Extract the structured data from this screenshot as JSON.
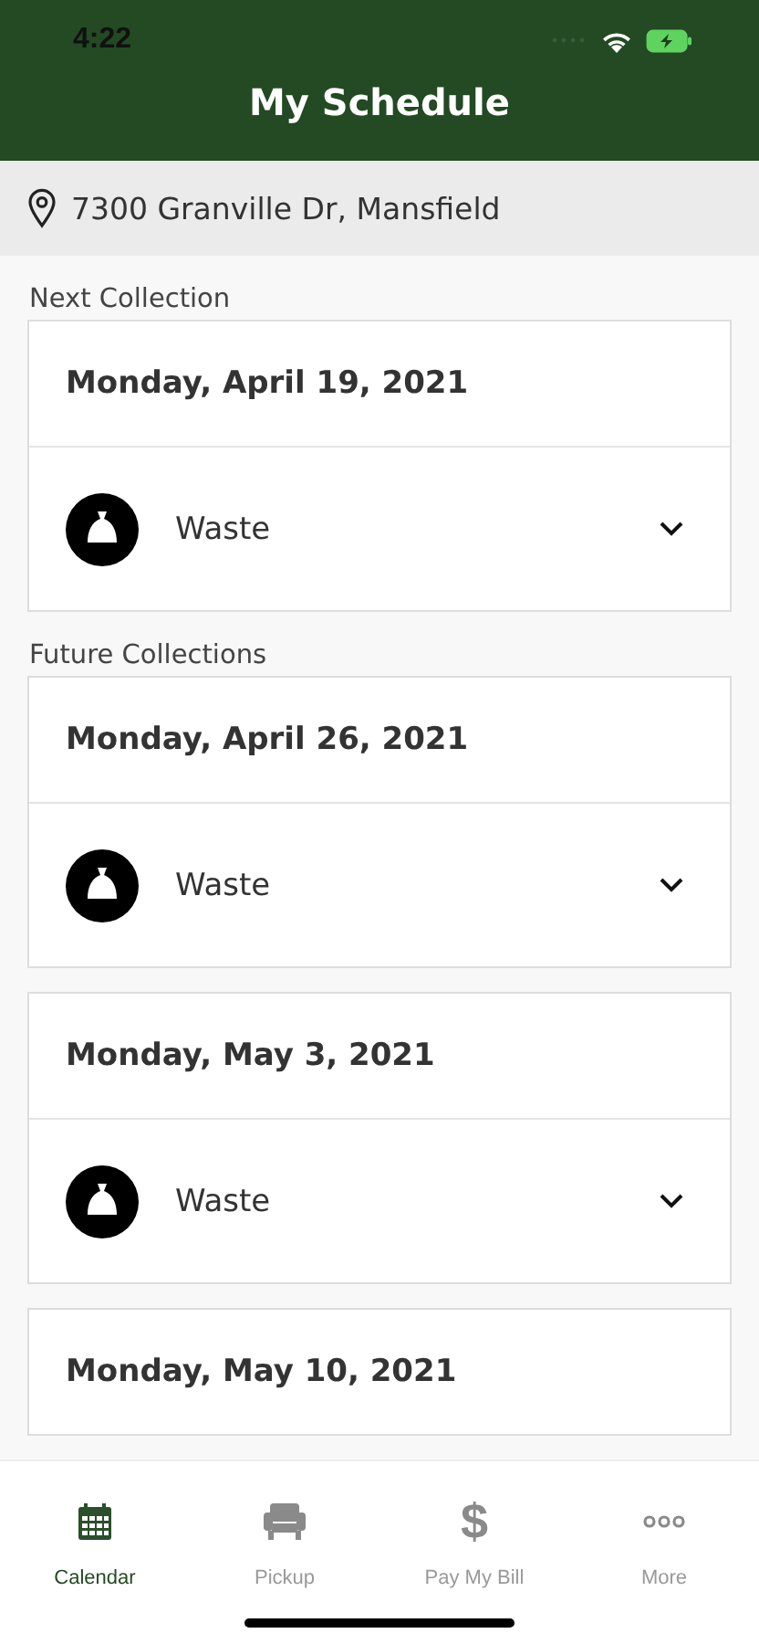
{
  "status_bar": {
    "time": "4:22"
  },
  "header": {
    "title": "My Schedule"
  },
  "address": {
    "text": "7300 Granville Dr, Mansfield"
  },
  "sections": [
    {
      "label": "Next Collection",
      "collections": [
        {
          "date": "Monday, April 19, 2021",
          "items": [
            {
              "kind": "waste",
              "label": "Waste",
              "expanded": false
            }
          ]
        }
      ]
    },
    {
      "label": "Future Collections",
      "collections": [
        {
          "date": "Monday, April 26, 2021",
          "items": [
            {
              "kind": "waste",
              "label": "Waste",
              "expanded": false
            }
          ]
        },
        {
          "date": "Monday, May 3, 2021",
          "items": [
            {
              "kind": "waste",
              "label": "Waste",
              "expanded": false
            }
          ]
        },
        {
          "date": "Monday, May 10, 2021"
        }
      ]
    }
  ],
  "tabs": [
    {
      "kind": "calendar",
      "label": "Calendar",
      "selected": true
    },
    {
      "kind": "pickup",
      "label": "Pickup",
      "selected": false
    },
    {
      "kind": "bill",
      "label": "Pay My Bill",
      "icon": "$",
      "selected": false
    },
    {
      "kind": "more",
      "label": "More",
      "selected": false
    }
  ]
}
